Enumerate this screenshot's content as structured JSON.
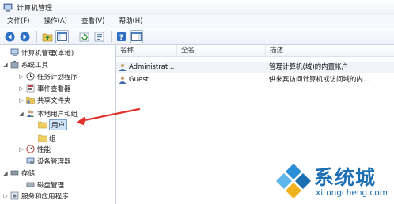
{
  "window": {
    "title": "计算机管理"
  },
  "menu": [
    "文件(F)",
    "操作(A)",
    "查看(V)",
    "帮助(H)"
  ],
  "toolbar": {
    "buttons": [
      {
        "icon": "back-arrow-icon"
      },
      {
        "icon": "forward-arrow-icon"
      },
      {
        "icon": "up-folder-icon"
      },
      {
        "icon": "show-tree-icon"
      },
      {
        "icon": "refresh-icon"
      },
      {
        "icon": "export-list-icon"
      },
      {
        "icon": "help-icon"
      },
      {
        "icon": "properties-icon"
      }
    ]
  },
  "tree": [
    {
      "label": "计算机管理(本地)",
      "expander": "",
      "icon": "computer-icon"
    },
    {
      "label": "系统工具",
      "expander": "◢",
      "icon": "tools-icon"
    },
    {
      "label": "任务计划程序",
      "expander": "▷",
      "icon": "clock-icon"
    },
    {
      "label": "事件查看器",
      "expander": "▷",
      "icon": "event-viewer-icon"
    },
    {
      "label": "共享文件夹",
      "expander": "▷",
      "icon": "shared-folder-icon"
    },
    {
      "label": "本地用户和组",
      "expander": "◢",
      "icon": "users-groups-icon"
    },
    {
      "label": "用户",
      "expander": "",
      "icon": "folder-icon"
    },
    {
      "label": "组",
      "expander": "",
      "icon": "folder-icon"
    },
    {
      "label": "性能",
      "expander": "▷",
      "icon": "performance-icon"
    },
    {
      "label": "设备管理器",
      "expander": "",
      "icon": "device-manager-icon"
    },
    {
      "label": "存储",
      "expander": "◢",
      "icon": "storage-icon"
    },
    {
      "label": "磁盘管理",
      "expander": "",
      "icon": "disk-icon"
    },
    {
      "label": "服务和应用程序",
      "expander": "▷",
      "icon": "services-icon"
    }
  ],
  "list": {
    "columns": [
      "名称",
      "全名",
      "描述"
    ],
    "rows": [
      {
        "name": "Administrat...",
        "full_name": "",
        "description": "管理计算机(域)的内置帐户"
      },
      {
        "name": "Guest",
        "full_name": "",
        "description": "供来宾访问计算机或访问域的内..."
      }
    ]
  },
  "watermark": {
    "brand": "系统城",
    "url": "xitongcheng.com"
  },
  "colors": {
    "accent": "#1d6fb3",
    "arrow": "#e0312b",
    "selection": "#cfe3fb"
  }
}
